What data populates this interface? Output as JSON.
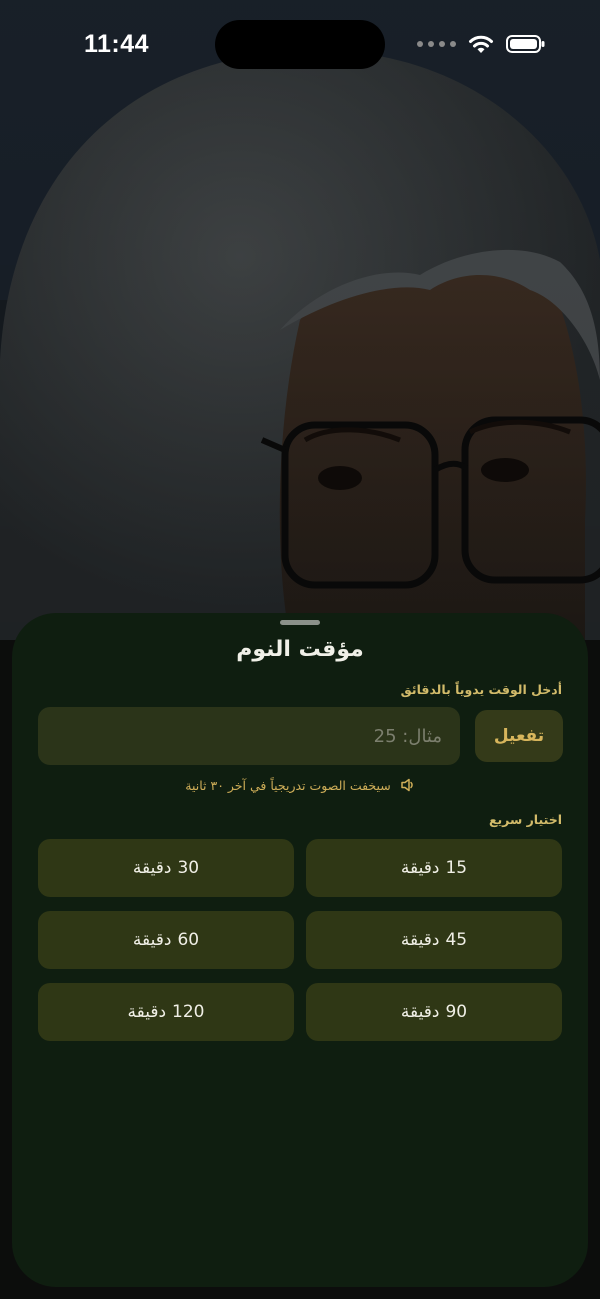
{
  "status_bar": {
    "time": "11:44",
    "icons": [
      "signal-dots-icon",
      "wifi-icon",
      "battery-icon"
    ]
  },
  "sheet": {
    "title": "مؤقت النوم",
    "manual": {
      "label": "أدخل الوقت يدوياً بالدقائق",
      "placeholder": "مثال: 25",
      "value": "",
      "button_label": "تفعيل"
    },
    "fade_note": {
      "icon": "speaker-icon",
      "text": "سيخفت الصوت تدريجياً في آخر ٣٠ ثانية"
    },
    "quick": {
      "label": "اختيار سريع",
      "options": [
        {
          "minutes": "15",
          "unit": "دقيقة"
        },
        {
          "minutes": "30",
          "unit": "دقيقة"
        },
        {
          "minutes": "45",
          "unit": "دقيقة"
        },
        {
          "minutes": "60",
          "unit": "دقيقة"
        },
        {
          "minutes": "90",
          "unit": "دقيقة"
        },
        {
          "minutes": "120",
          "unit": "دقيقة"
        }
      ]
    }
  },
  "colors": {
    "sheet_bg": "#0f1e10",
    "accent_gold": "#d7b55c",
    "button_bg": "#2f3715",
    "input_bg": "#2b3419"
  }
}
